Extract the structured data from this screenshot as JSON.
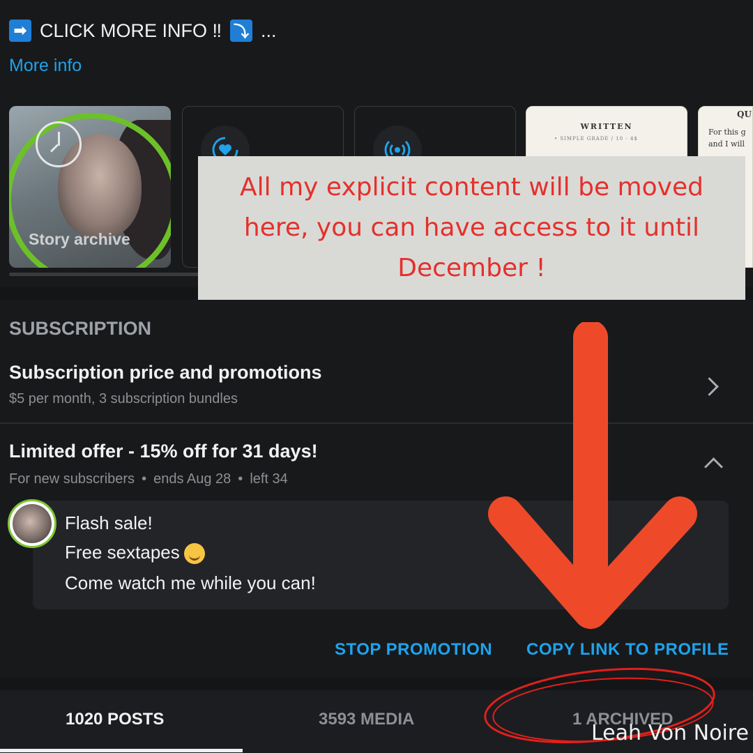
{
  "header": {
    "arrow_emoji": "➡",
    "title": "CLICK MORE INFO ‼",
    "down_emoji": "⤵",
    "ellipsis": "...",
    "more_info_link": "More info"
  },
  "highlights": [
    {
      "label": "Story archive",
      "icon": "clock-history-icon"
    },
    {
      "icon": "heart-circle-icon"
    },
    {
      "icon": "broadcast-icon"
    },
    {
      "title": "WRITTEN",
      "line1": "• SIMPLE GRADE / 10 - 4$"
    },
    {
      "title": "QU",
      "text": "For this g and I will"
    }
  ],
  "note": {
    "text": "All my explicit content will be moved here, you can have access to it until December !"
  },
  "subscription": {
    "heading": "SUBSCRIPTION",
    "price_title": "Subscription price and promotions",
    "price_sub": "$5 per month, 3 subscription bundles",
    "offer_title": "Limited offer - 15% off for 31 days!",
    "offer_meta": [
      "For new subscribers",
      "ends Aug 28",
      "left 34"
    ],
    "meta_separator": "•"
  },
  "promo": {
    "line1": "Flash sale!",
    "line2": "Free sextapes",
    "line3": "Come watch me while you can!"
  },
  "actions": {
    "stop": "STOP PROMOTION",
    "copy": "COPY LINK TO PROFILE"
  },
  "tabs": {
    "posts": "1020 POSTS",
    "media": "3593 MEDIA",
    "archived": "1 ARCHIVED"
  },
  "watermark": "Leah Von Noire",
  "colors": {
    "background": "#18191b",
    "accent_blue": "#1ea3ec",
    "annotation_red": "#e5302c",
    "story_ring_green": "#6cc129"
  }
}
